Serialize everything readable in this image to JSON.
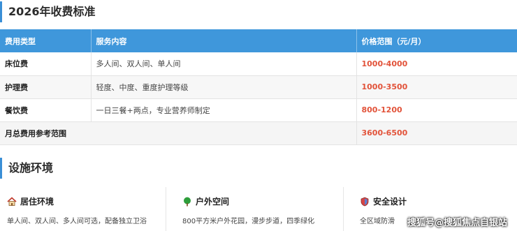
{
  "fees_section": {
    "title": "2026年收费标准",
    "columns": [
      "费用类型",
      "服务内容",
      "价格范围（元/月）"
    ],
    "rows": [
      {
        "type": "床位费",
        "content": "多人间、双人间、单人间",
        "price": "1000-4000"
      },
      {
        "type": "护理费",
        "content": "轻度、中度、重度护理等级",
        "price": "1000-3500"
      },
      {
        "type": "餐饮费",
        "content": "一日三餐+两点，专业营养师制定",
        "price": "800-1200"
      }
    ],
    "total": {
      "label": "月总费用参考范围",
      "price": "3600-6500"
    }
  },
  "facility_section": {
    "title": "设施环境",
    "cards": [
      {
        "icon": "house-icon",
        "title": "居住环境",
        "desc": "单人间、双人间、多人间可选，配备独立卫浴"
      },
      {
        "icon": "tree-icon",
        "title": "户外空间",
        "desc": "800平方米户外花园，漫步步道，四季绿化"
      },
      {
        "icon": "shield-icon",
        "title": "安全设计",
        "desc": "全区域防滑"
      }
    ]
  },
  "watermark": "搜狐号@搜狐焦点自银站",
  "colors": {
    "accent": "#3f97db",
    "price": "#e2533a"
  }
}
